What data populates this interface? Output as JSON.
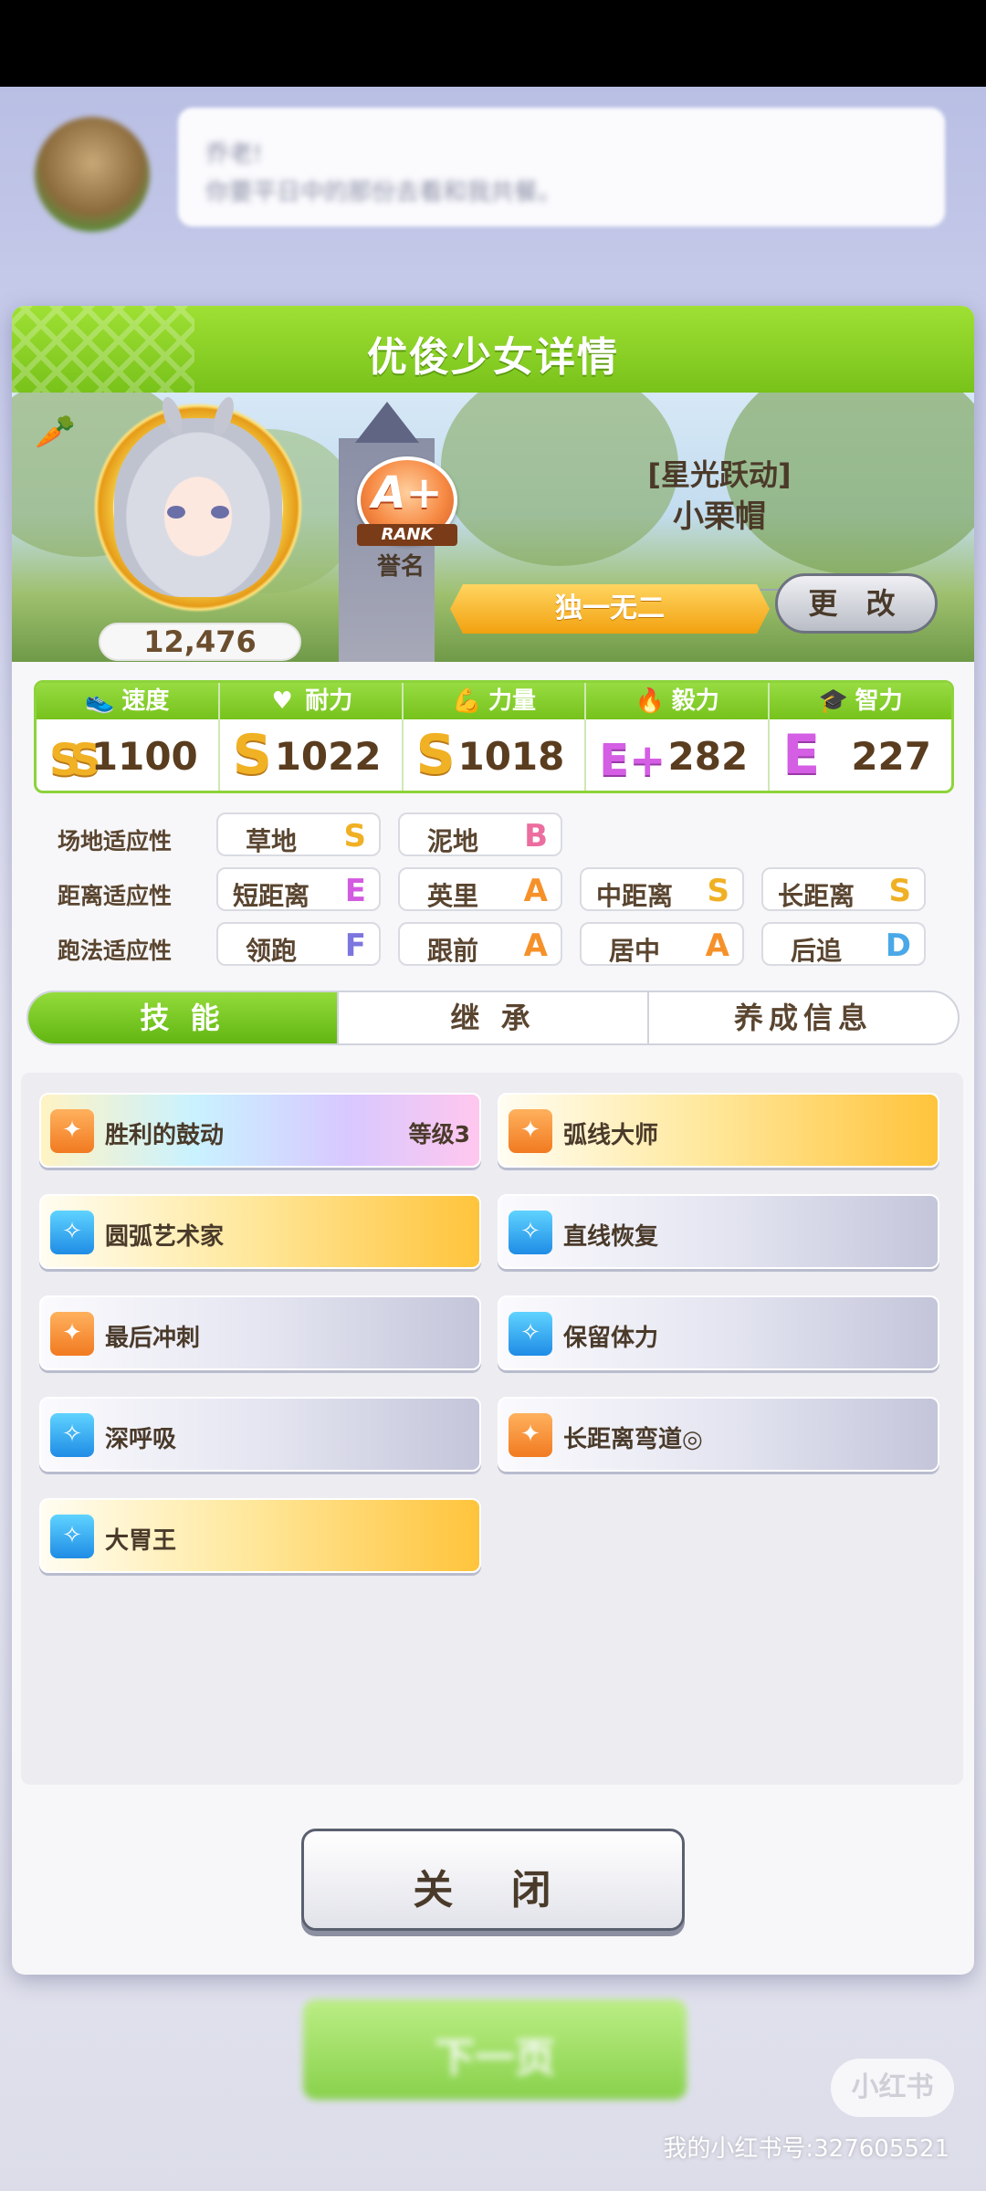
{
  "background": {
    "dialog_line1": "乔老!",
    "dialog_line2": "你要平日中的那份去看和我共餐。",
    "next_button": "下一页"
  },
  "panel": {
    "title": "优俊少女详情",
    "score": "12,476",
    "rank": {
      "grade": "A+",
      "rank_word": "RANK",
      "label": "誉名"
    },
    "epithet": "[星光跃动]",
    "character_name": "小栗帽",
    "title_ribbon": "独一无二",
    "change_button": "更 改"
  },
  "stats": [
    {
      "name": "速度",
      "icon": "shoe-icon",
      "grade": "SS",
      "value": "1100",
      "grade_color": "gold"
    },
    {
      "name": "耐力",
      "icon": "heart-icon",
      "grade": "S",
      "value": "1022",
      "grade_color": "gold"
    },
    {
      "name": "力量",
      "icon": "arm-icon",
      "grade": "S",
      "value": "1018",
      "grade_color": "gold"
    },
    {
      "name": "毅力",
      "icon": "flame-icon",
      "grade": "E+",
      "value": "282",
      "grade_color": "purple"
    },
    {
      "name": "智力",
      "icon": "graduation-cap-icon",
      "grade": "E",
      "value": "227",
      "grade_color": "purple"
    }
  ],
  "aptitudes": {
    "track": {
      "label": "场地适应性",
      "items": [
        {
          "name": "草地",
          "grade": "S"
        },
        {
          "name": "泥地",
          "grade": "B"
        }
      ]
    },
    "distance": {
      "label": "距离适应性",
      "items": [
        {
          "name": "短距离",
          "grade": "E"
        },
        {
          "name": "英里",
          "grade": "A"
        },
        {
          "name": "中距离",
          "grade": "S"
        },
        {
          "name": "长距离",
          "grade": "S"
        }
      ]
    },
    "style": {
      "label": "跑法适应性",
      "items": [
        {
          "name": "领跑",
          "grade": "F"
        },
        {
          "name": "跟前",
          "grade": "A"
        },
        {
          "name": "居中",
          "grade": "A"
        },
        {
          "name": "后追",
          "grade": "D"
        }
      ]
    }
  },
  "tabs": [
    {
      "label": "技 能",
      "active": true
    },
    {
      "label": "继 承",
      "active": false
    },
    {
      "label": "养成信息",
      "active": false
    }
  ],
  "skills": [
    {
      "name": "胜利的鼓动",
      "level": "等级3",
      "style": "rainbow",
      "icon": "orange"
    },
    {
      "name": "弧线大师",
      "level": "",
      "style": "gold",
      "icon": "orange"
    },
    {
      "name": "圆弧艺术家",
      "level": "",
      "style": "gold",
      "icon": "blue"
    },
    {
      "name": "直线恢复",
      "level": "",
      "style": "white",
      "icon": "blue"
    },
    {
      "name": "最后冲刺",
      "level": "",
      "style": "white",
      "icon": "orange"
    },
    {
      "name": "保留体力",
      "level": "",
      "style": "white",
      "icon": "blue"
    },
    {
      "name": "深呼吸",
      "level": "",
      "style": "white",
      "icon": "blue"
    },
    {
      "name": "长距离弯道◎",
      "level": "",
      "style": "white",
      "icon": "orange"
    },
    {
      "name": "大胃王",
      "level": "",
      "style": "gold",
      "icon": "blue"
    }
  ],
  "close_button": "关 闭",
  "watermark": {
    "logo": "小红书",
    "id": "我的小红书号:327605521"
  }
}
